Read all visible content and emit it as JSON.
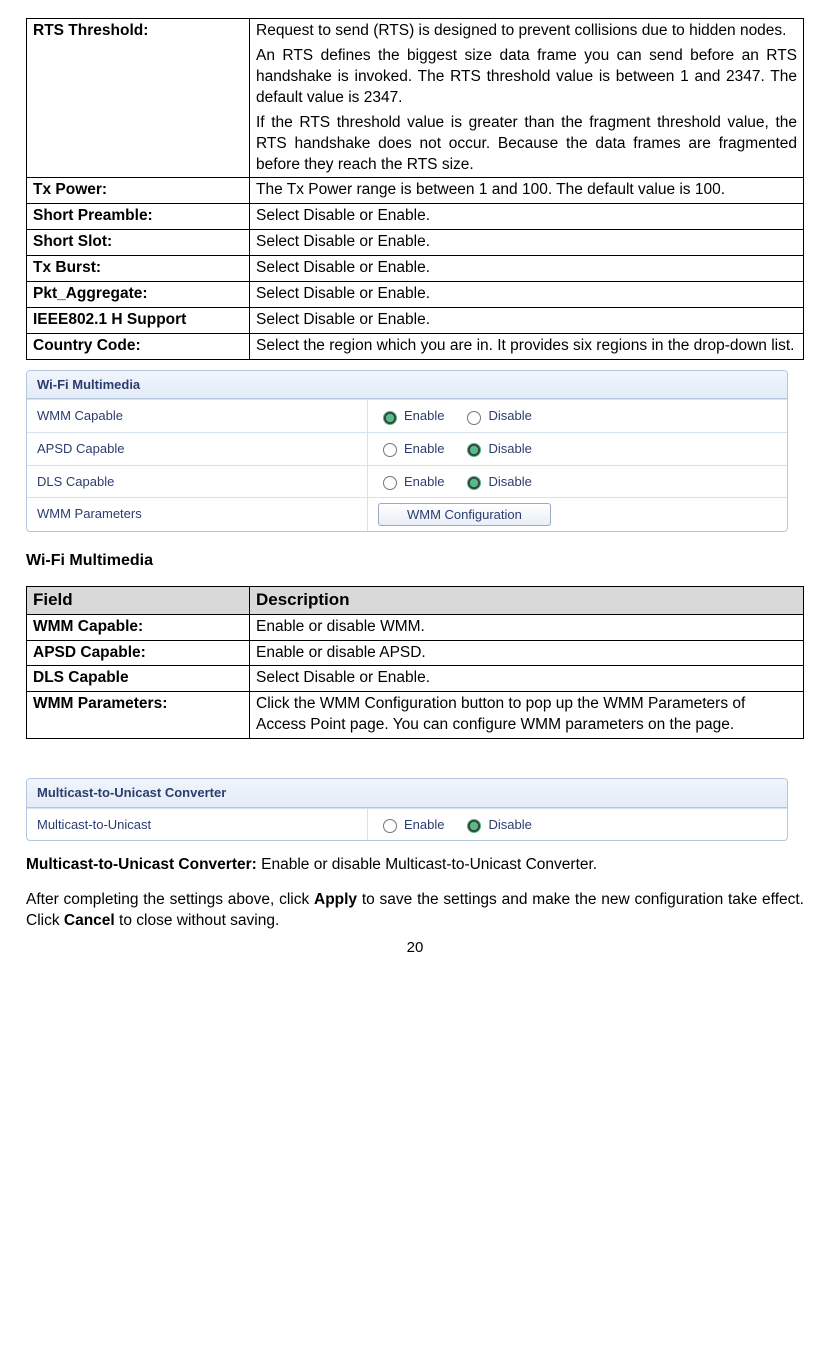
{
  "table1": {
    "rows": [
      {
        "label": "RTS Threshold:",
        "desc_paras": [
          "Request to send (RTS) is designed to prevent collisions due to hidden nodes.",
          "An RTS defines the biggest size data frame you can send before an RTS handshake is invoked. The RTS threshold value is between 1 and 2347. The default value is 2347.",
          "If the RTS threshold value is greater than the fragment threshold value, the RTS handshake does not occur. Because the data frames are fragmented before they reach the RTS size."
        ]
      },
      {
        "label": "Tx Power:",
        "desc": "The Tx Power range is between 1 and 100. The default value is 100."
      },
      {
        "label": "Short Preamble:",
        "desc": "Select Disable or Enable."
      },
      {
        "label": "Short Slot:",
        "desc": "Select Disable or Enable."
      },
      {
        "label": "Tx Burst:",
        "desc": "Select Disable or Enable."
      },
      {
        "label": "Pkt_Aggregate:",
        "desc": "Select Disable or Enable."
      },
      {
        "label": "IEEE802.1 H Support",
        "desc": "Select Disable or Enable."
      },
      {
        "label": "Country Code:",
        "desc": "Select the region which you are in. It provides six regions in the drop-down list."
      }
    ]
  },
  "wifi_panel": {
    "title": "Wi-Fi Multimedia",
    "rows": [
      {
        "label": "WMM Capable",
        "enable": "Enable",
        "disable": "Disable",
        "selected": "enable"
      },
      {
        "label": "APSD Capable",
        "enable": "Enable",
        "disable": "Disable",
        "selected": "disable"
      },
      {
        "label": "DLS Capable",
        "enable": "Enable",
        "disable": "Disable",
        "selected": "disable"
      },
      {
        "label": "WMM Parameters",
        "button": "WMM Configuration"
      }
    ]
  },
  "section_wmm_heading": "Wi-Fi Multimedia",
  "table2": {
    "header": {
      "field": "Field",
      "desc": "Description"
    },
    "rows": [
      {
        "label": "WMM Capable:",
        "desc": "Enable or disable WMM."
      },
      {
        "label": "APSD Capable:",
        "desc": "Enable or disable APSD."
      },
      {
        "label": "DLS Capable",
        "desc": "Select Disable or Enable."
      },
      {
        "label": "WMM Parameters:",
        "desc": "Click the WMM Configuration button to pop up the WMM Parameters of Access Point page. You can configure WMM parameters on the page."
      }
    ]
  },
  "mcu_panel": {
    "title": "Multicast-to-Unicast Converter",
    "row": {
      "label": "Multicast-to-Unicast",
      "enable": "Enable",
      "disable": "Disable",
      "selected": "disable"
    }
  },
  "mcu_text": {
    "bold": "Multicast-to-Unicast Converter: ",
    "rest": "Enable or disable Multicast-to-Unicast Converter."
  },
  "after_text": {
    "p1a": "After completing the settings above, click ",
    "apply": "Apply",
    "p1b": " to save the settings and make the new configuration take effect. Click ",
    "cancel": "Cancel",
    "p1c": " to close without saving."
  },
  "page_number": "20"
}
